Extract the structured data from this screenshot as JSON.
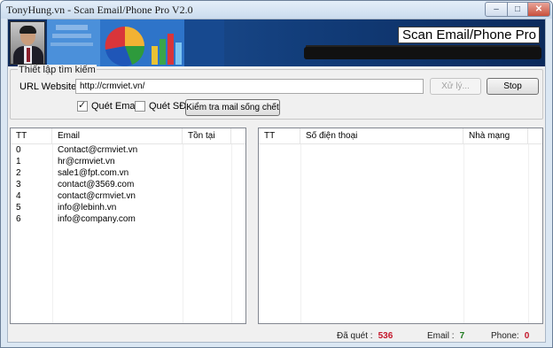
{
  "window": {
    "title": "TonyHung.vn - Scan Email/Phone Pro V2.0"
  },
  "titlebar": {
    "minimize": "–",
    "maximize": "□",
    "close": "✕"
  },
  "banner": {
    "app_name": "Scan Email/Phone Pro"
  },
  "search": {
    "group_label": "Thiết lập tìm kiếm",
    "url_label": "URL Website :",
    "url_value": "http://crmviet.vn/",
    "process_button": "Xử lý...",
    "stop_button": "Stop",
    "scan_email_label": "Quét Email",
    "scan_email_checked": true,
    "scan_phone_label": "Quét SĐT",
    "scan_phone_checked": false,
    "check_button": "Kiểm tra mail sống chết"
  },
  "email_table": {
    "columns": [
      "TT",
      "Email",
      "Tồn tại"
    ],
    "rows": [
      {
        "tt": "0",
        "email": "Contact@crmviet.vn",
        "exists": ""
      },
      {
        "tt": "1",
        "email": "hr@crmviet.vn",
        "exists": ""
      },
      {
        "tt": "2",
        "email": "sale1@fpt.com.vn",
        "exists": ""
      },
      {
        "tt": "3",
        "email": "contact@3569.com",
        "exists": ""
      },
      {
        "tt": "4",
        "email": "contact@crmviet.vn",
        "exists": ""
      },
      {
        "tt": "5",
        "email": "info@lebinh.vn",
        "exists": ""
      },
      {
        "tt": "6",
        "email": "info@company.com",
        "exists": ""
      }
    ]
  },
  "phone_table": {
    "columns": [
      "TT",
      "Số điện thoại",
      "Nhà mạng"
    ],
    "rows": []
  },
  "status_bar": {
    "scanned_label": "Đã quét :",
    "scanned_value": "536",
    "email_label": "Email :",
    "email_value": "7",
    "phone_label": "Phone:",
    "phone_value": "0"
  }
}
